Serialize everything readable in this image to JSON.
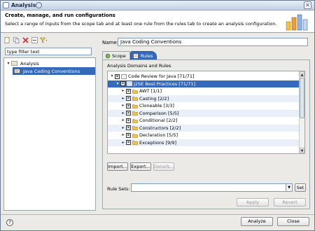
{
  "window": {
    "title": "Analysis",
    "close_glyph": "✕"
  },
  "header": {
    "title": "Create, manage, and run configurations",
    "description": "Select a range of inputs from the scope tab and at least one rule from the rules tab to create an analysis configuration."
  },
  "left": {
    "toolbar_icons": [
      "new-config-icon",
      "duplicate-icon",
      "delete-icon",
      "collapse-all-icon",
      "filter-icon"
    ],
    "filter_placeholder": "type filter text",
    "filter_value": "type filter text",
    "tree": [
      {
        "label": "Analysis",
        "level": 0,
        "expanded": true
      },
      {
        "label": "Java Coding Conventions",
        "level": 1,
        "selected": true
      }
    ]
  },
  "form": {
    "name_label": "Name:",
    "name_value": "Java Coding Conventions",
    "tabs": [
      {
        "label": "Scope",
        "active": false
      },
      {
        "label": "Rules",
        "active": true
      }
    ],
    "section_label": "Analysis Domains and Rules",
    "rules": [
      {
        "label": "Code Review for Java [71/71]",
        "level": 0,
        "expanded": true
      },
      {
        "label": "J2SE Best Practices [71/71]",
        "level": 1,
        "expanded": true,
        "selected": true
      },
      {
        "label": "AWT [1/1]",
        "level": 2
      },
      {
        "label": "Casting [2/2]",
        "level": 2
      },
      {
        "label": "Cloneable [3/3]",
        "level": 2
      },
      {
        "label": "Comparison [5/5]",
        "level": 2
      },
      {
        "label": "Conditional [2/2]",
        "level": 2
      },
      {
        "label": "Constructors [2/2]",
        "level": 2
      },
      {
        "label": "Declaration [5/5]",
        "level": 2
      },
      {
        "label": "Exceptions [9/9]",
        "level": 2
      }
    ],
    "buttons": {
      "import": "Import...",
      "export": "Export...",
      "details": "Details..."
    },
    "rule_sets_label": "Rule Sets:",
    "rule_sets_value": "",
    "set_button": "Set",
    "apply_button": "Apply",
    "revert_button": "Revert"
  },
  "footer": {
    "analyze_button": "Analyze",
    "close_button": "Close"
  },
  "colors": {
    "selection": "#3569b9",
    "accent": "#2b528f"
  }
}
